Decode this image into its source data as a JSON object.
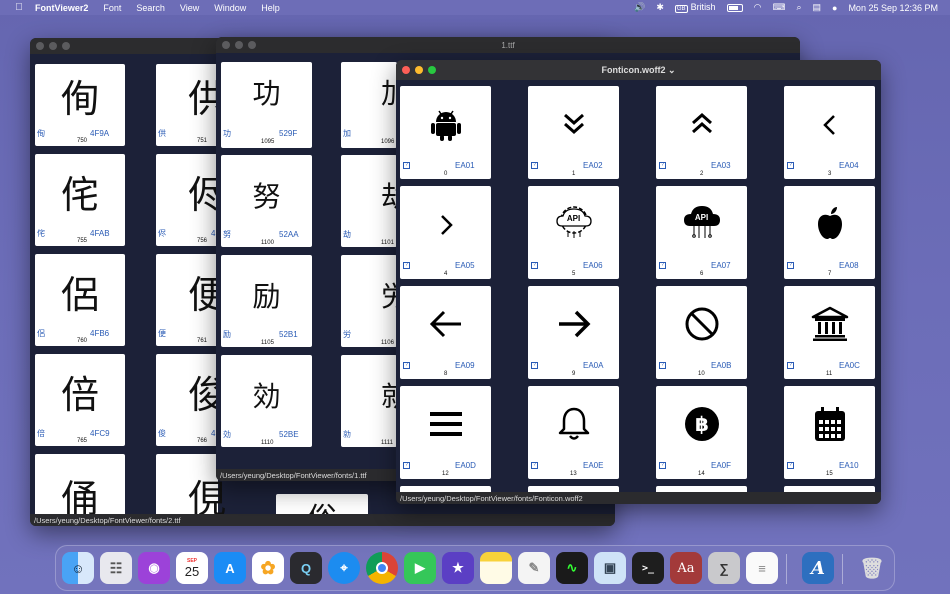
{
  "menubar": {
    "app_name": "FontViewer2",
    "menus": [
      "Font",
      "Search",
      "View",
      "Window",
      "Help"
    ],
    "input_source_badge": "GB",
    "input_source": "British",
    "datetime": "Mon 25 Sep  12:36 PM"
  },
  "window_back": {
    "title": "",
    "status_path": "/Users/yeung/Desktop/FontViewer/fonts/2.ttf",
    "cards": [
      {
        "glyph": "侚",
        "code": "4F9A",
        "index": "750"
      },
      {
        "glyph": "侘",
        "code": "4FAB",
        "index": "755"
      },
      {
        "glyph": "侶",
        "code": "4FB6",
        "index": "760"
      },
      {
        "glyph": "倍",
        "code": "4FC9",
        "index": "765"
      },
      {
        "glyph": "俑",
        "code": "",
        "index": ""
      }
    ],
    "cards_col2": [
      {
        "glyph": "供",
        "code": "4",
        "index": "751"
      },
      {
        "glyph": "侭",
        "code": "4",
        "index": "756"
      },
      {
        "glyph": "便",
        "code": "4",
        "index": "761"
      },
      {
        "glyph": "俊",
        "code": "4",
        "index": "766"
      },
      {
        "glyph": "俔",
        "code": "",
        "index": ""
      }
    ],
    "partial_glyph": "俗"
  },
  "window_mid": {
    "title": "1.ttf",
    "status_path": "/Users/yeung/Desktop/FontViewer/fonts/1.ttf",
    "cards": [
      {
        "glyph": "功",
        "code": "529F",
        "index": "1095"
      },
      {
        "glyph": "努",
        "code": "52AA",
        "index": "1100"
      },
      {
        "glyph": "励",
        "code": "52B1",
        "index": "1105"
      },
      {
        "glyph": "効",
        "code": "52BE",
        "index": "1110"
      }
    ],
    "cards_col2": [
      {
        "glyph": "加",
        "index": "1096"
      },
      {
        "glyph": "劫",
        "index": "1101"
      },
      {
        "glyph": "労",
        "index": "1106"
      },
      {
        "glyph": "勍",
        "index": "1111"
      }
    ]
  },
  "window_front": {
    "title": "Fonticon.woff2",
    "status_path": "/Users/yeung/Desktop/FontViewer/fonts/Fonticon.woff2",
    "cards": [
      {
        "icon": "android-icon",
        "code": "EA01",
        "index": "0"
      },
      {
        "icon": "chevrons-down-icon",
        "code": "EA02",
        "index": "1"
      },
      {
        "icon": "chevrons-up-icon",
        "code": "EA03",
        "index": "2"
      },
      {
        "icon": "chevron-left-icon",
        "code": "EA04",
        "index": "3"
      },
      {
        "icon": "chevron-right-icon",
        "code": "EA05",
        "index": "4"
      },
      {
        "icon": "api-gear-cloud-icon",
        "code": "EA06",
        "index": "5",
        "label": "API"
      },
      {
        "icon": "api-cloud-circuit-icon",
        "code": "EA07",
        "index": "6",
        "label": "API"
      },
      {
        "icon": "apple-icon",
        "code": "EA08",
        "index": "7"
      },
      {
        "icon": "arrow-left-icon",
        "code": "EA09",
        "index": "8"
      },
      {
        "icon": "arrow-right-icon",
        "code": "EA0A",
        "index": "9"
      },
      {
        "icon": "ban-icon",
        "code": "EA0B",
        "index": "10"
      },
      {
        "icon": "bank-icon",
        "code": "EA0C",
        "index": "11"
      },
      {
        "icon": "bars-icon",
        "code": "EA0D",
        "index": "12"
      },
      {
        "icon": "bell-icon",
        "code": "EA0E",
        "index": "13"
      },
      {
        "icon": "bitcoin-icon",
        "code": "EA0F",
        "index": "14"
      },
      {
        "icon": "calendar-icon",
        "code": "EA10",
        "index": "15"
      }
    ]
  },
  "dock": {
    "calendar_month": "SEP",
    "calendar_day": "25",
    "dictionary_label": "Aa",
    "items": [
      "finder-icon",
      "launchpad-icon",
      "podcasts-icon",
      "calendar-icon",
      "app-store-icon",
      "photos-icon",
      "quicktime-icon",
      "safari-icon",
      "chrome-icon",
      "facetime-icon",
      "imovie-icon",
      "notes-icon",
      "script-editor-icon",
      "activity-monitor-icon",
      "preview-icon",
      "terminal-icon",
      "dictionary-icon",
      "calculator-icon",
      "textedit-icon",
      "fontviewer-icon",
      "trash-icon"
    ]
  }
}
